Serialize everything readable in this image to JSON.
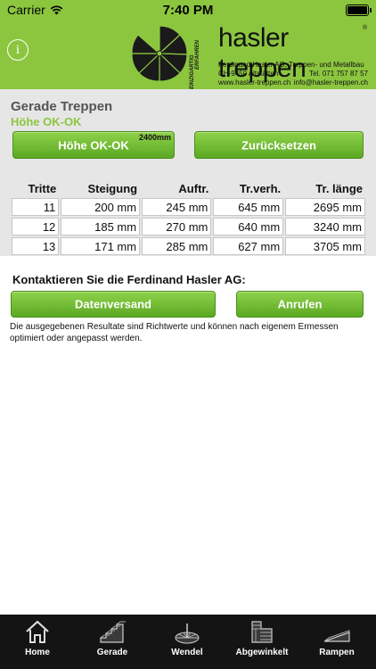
{
  "status": {
    "carrier": "Carrier",
    "time": "7:40 PM"
  },
  "header": {
    "brand": "hasler treppen",
    "registered": "®",
    "tagline": [
      "EINZIGARTIG",
      "ERFAHREN"
    ],
    "address_line1": "Ferdinand Hasler AG, Treppen- und Metallbau",
    "address_city": "CH-9450 Altstätten",
    "address_tel": "Tel. 071 757 87 57",
    "address_web": "www.hasler-treppen.ch",
    "address_mail": "info@hasler-treppen.ch"
  },
  "section": {
    "title": "Gerade Treppen",
    "subtitle": "Höhe OK-OK"
  },
  "buttons": {
    "height": "Höhe OK-OK",
    "height_badge": "2400mm",
    "reset": "Zurücksetzen"
  },
  "table": {
    "headers": [
      "Tritte",
      "Steigung",
      "Auftr.",
      "Tr.verh.",
      "Tr. länge"
    ],
    "rows": [
      [
        "11",
        "200 mm",
        "245 mm",
        "645 mm",
        "2695 mm"
      ],
      [
        "12",
        "185 mm",
        "270 mm",
        "640 mm",
        "3240 mm"
      ],
      [
        "13",
        "171 mm",
        "285 mm",
        "627 mm",
        "3705 mm"
      ]
    ]
  },
  "contact": {
    "title": "Kontaktieren Sie die Ferdinand Hasler AG:",
    "send": "Datenversand",
    "call": "Anrufen",
    "note": "Die ausgegebenen Resultate sind Richtwerte und können nach eigenem Ermessen optimiert oder angepasst werden."
  },
  "tabs": [
    {
      "label": "Home",
      "icon": "home-icon"
    },
    {
      "label": "Gerade",
      "icon": "straight-stairs-icon"
    },
    {
      "label": "Wendel",
      "icon": "spiral-stairs-icon"
    },
    {
      "label": "Abgewinkelt",
      "icon": "angled-stairs-icon"
    },
    {
      "label": "Rampen",
      "icon": "ramp-icon"
    }
  ],
  "colors": {
    "brand_green": "#8cc63f",
    "button_green": "#6cbb2e",
    "tabbar": "#141414"
  }
}
